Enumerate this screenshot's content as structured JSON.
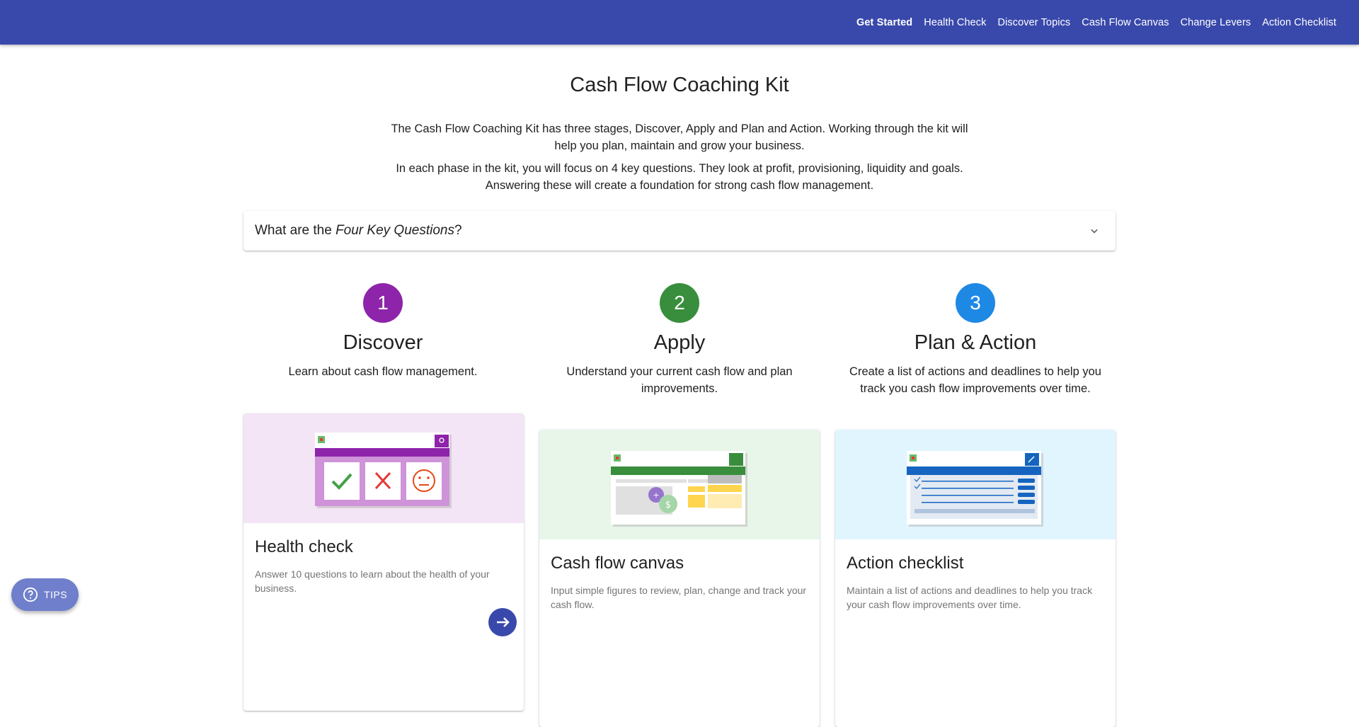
{
  "nav": {
    "items": [
      {
        "label": "Get Started",
        "active": true
      },
      {
        "label": "Health Check"
      },
      {
        "label": "Discover Topics"
      },
      {
        "label": "Cash Flow Canvas"
      },
      {
        "label": "Change Levers"
      },
      {
        "label": "Action Checklist"
      }
    ]
  },
  "page": {
    "title": "Cash Flow Coaching Kit",
    "intro": [
      "The Cash Flow Coaching Kit has three stages, Discover, Apply and Plan and Action. Working through the kit will help you plan, maintain and grow your business.",
      "In each phase in the kit, you will focus on 4 key questions. They look at profit, provisioning, liquidity and goals. Answering these will create a foundation for strong cash flow management."
    ]
  },
  "accordion": {
    "prefix": "What are the ",
    "emphasis": "Four Key Questions",
    "suffix": "?"
  },
  "stages": [
    {
      "number": "1",
      "title": "Discover",
      "description": "Learn about cash flow management.",
      "color": "#8e24aa"
    },
    {
      "number": "2",
      "title": "Apply",
      "description": "Understand your current cash flow and plan improvements.",
      "color": "#388e3c"
    },
    {
      "number": "3",
      "title": "Plan & Action",
      "description": "Create a list of actions and deadlines to help you track you cash flow improvements over time.",
      "color": "#1e88e5"
    }
  ],
  "cards": [
    {
      "title": "Health check",
      "description": "Answer 10 questions to learn about the health of your business.",
      "media_color": "#f3e5f5",
      "accent": "#8e24aa"
    },
    {
      "title": "Cash flow canvas",
      "description": "Input simple figures to review, plan, change and track your cash flow.",
      "media_color": "#e8f5e9",
      "accent": "#388e3c"
    },
    {
      "title": "Action checklist",
      "description": "Maintain a list of actions and deadlines to help you track your cash flow improvements over time.",
      "media_color": "#e1f5fe",
      "accent": "#1565c0"
    }
  ],
  "tips": {
    "label": "TIPS",
    "icon": "help-circle-icon"
  },
  "colors": {
    "appbar": "#3949ab",
    "tips": "#6f7fcb"
  }
}
